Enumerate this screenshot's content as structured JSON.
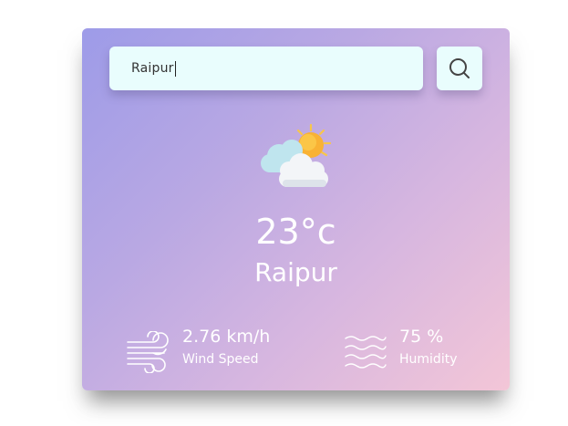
{
  "search": {
    "value": "Raipur"
  },
  "weather": {
    "icon": "sun-behind-clouds-icon",
    "temperature": "23°c",
    "city": "Raipur"
  },
  "details": {
    "wind_speed": "2.76 km/h",
    "wind_label": "Wind Speed",
    "humidity": "75 %",
    "humidity_label": "Humidity"
  }
}
